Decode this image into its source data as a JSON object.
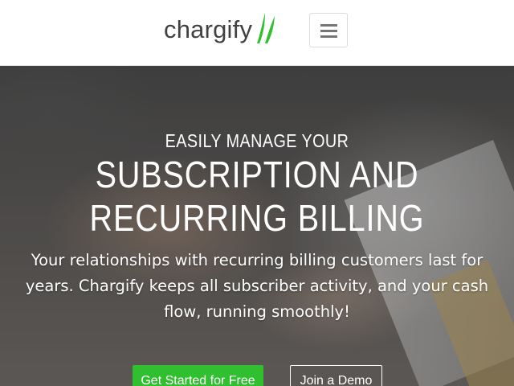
{
  "header": {
    "logo_text": "chargify",
    "logo_mark_icon": "green-double-stroke-icon",
    "menu_icon": "hamburger-menu-icon",
    "brand_color": "#2fbf2f"
  },
  "hero": {
    "eyebrow": "EASILY MANAGE YOUR",
    "headline_line1": "SUBSCRIPTION AND",
    "headline_line2": "RECURRING BILLING",
    "subtext": "Your relationships with recurring billing customers last for years. Chargify keeps all subscriber activity, and your cash flow, running smoothly!",
    "primary_button": "Get Started for Free",
    "secondary_button": "Join a Demo"
  }
}
